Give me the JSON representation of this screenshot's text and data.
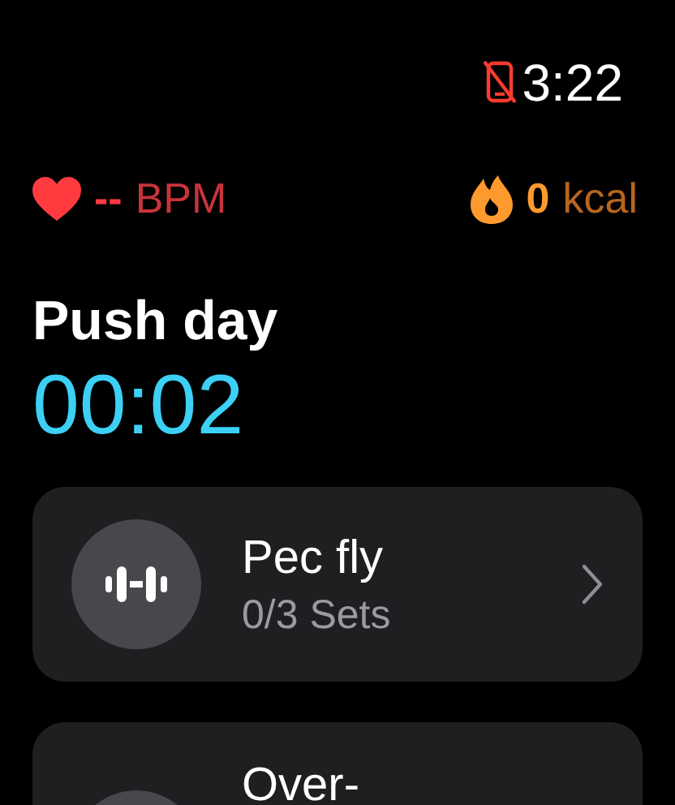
{
  "status_bar": {
    "phone_disconnected": true,
    "time": "3:22"
  },
  "metrics": {
    "heart_rate": "--",
    "heart_unit": "BPM",
    "calories": "0",
    "calories_unit": "kcal"
  },
  "workout": {
    "title": "Push day",
    "elapsed": "00:02"
  },
  "exercises": [
    {
      "name": "Pec fly",
      "sets": "0/3 Sets"
    },
    {
      "name": "Over-"
    }
  ]
}
